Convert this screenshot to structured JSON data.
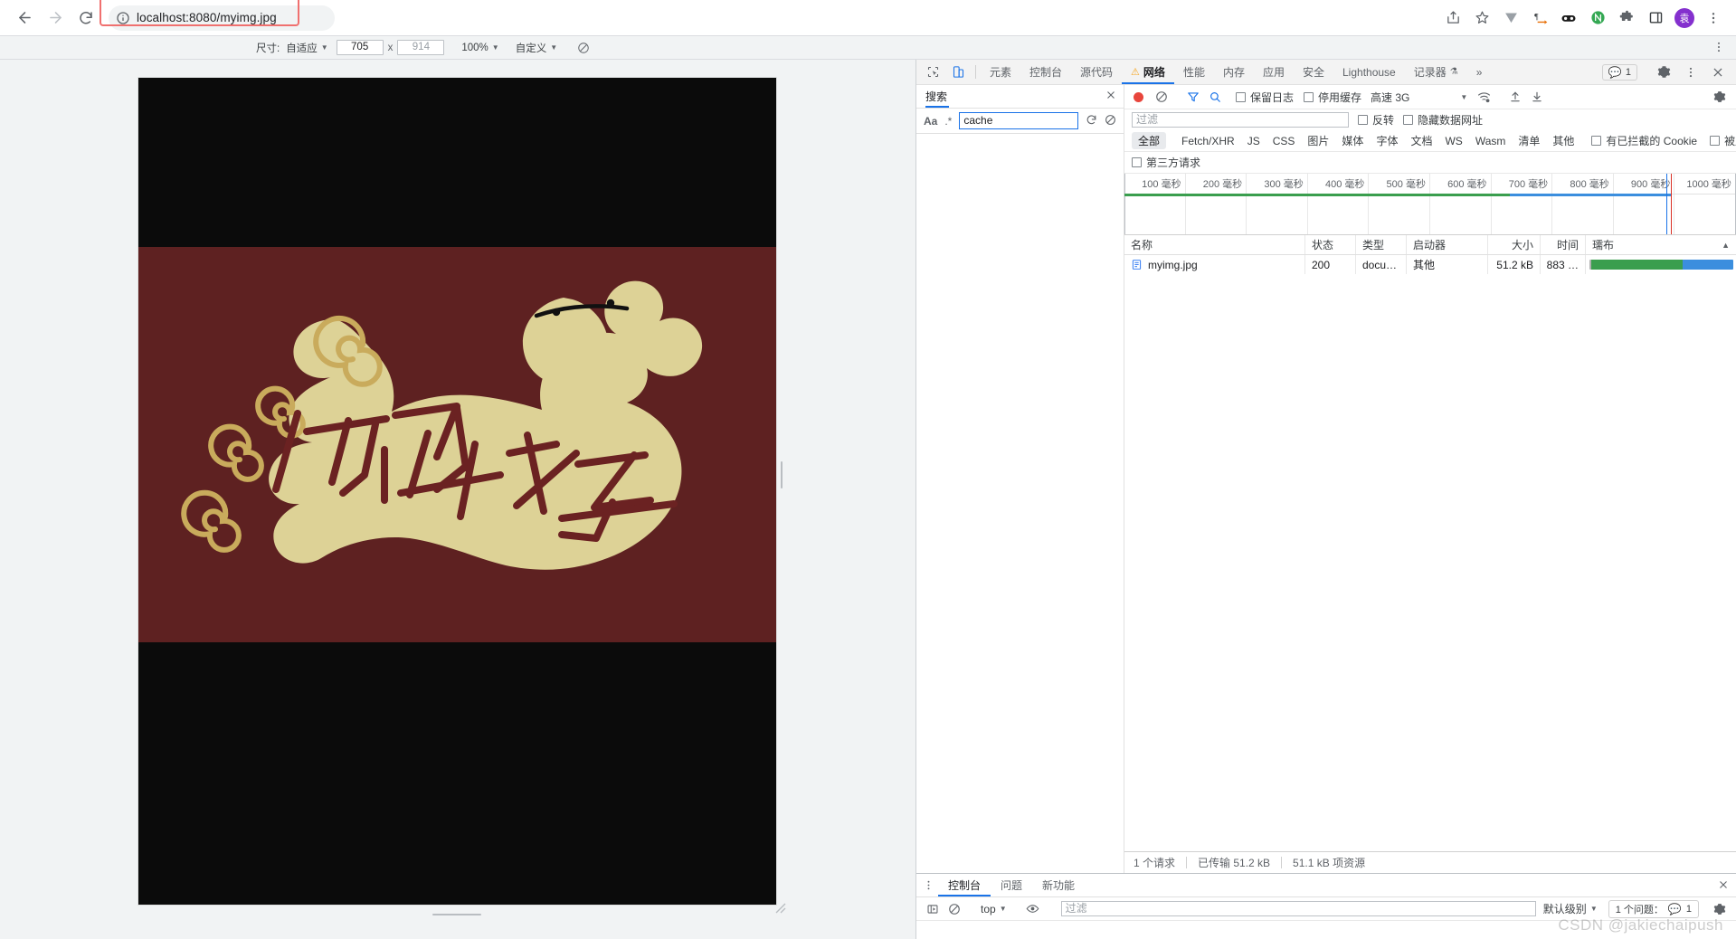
{
  "browser": {
    "back_icon": "arrow-left-icon",
    "forward_icon": "arrow-right-icon",
    "reload_icon": "reload-icon",
    "site_info_icon": "info-circle-icon",
    "url": "localhost:8080/myimg.jpg",
    "toolbar_icons": [
      "share-icon",
      "bookmark-star-icon",
      "vimium-icon",
      "paragraph-icon",
      "glasses-icon",
      "notion-icon",
      "extensions-puzzle-icon",
      "side-panel-icon",
      "profile-avatar",
      "chrome-menu-kebab-icon"
    ],
    "avatar_glyph": "袁"
  },
  "device_toolbar": {
    "size_label": "尺寸:",
    "size_value": "自适应",
    "width": "705",
    "x_separator": "x",
    "height": "914",
    "zoom": "100%",
    "throttle_preset": "自定义",
    "rotate_icon": "rotate-device-icon",
    "kebab_icon": "more-options-kebab-icon"
  },
  "page_image": {
    "colors": {
      "band": "#0b0b0b",
      "background": "#5e2121",
      "creature": "#ddd296",
      "spiral": "#c9ab5c",
      "stroke": "#6b2222",
      "face": "#111111"
    },
    "caption_text": "你好"
  },
  "devtools": {
    "left_icons": [
      "inspect-element-icon",
      "toggle-device-toolbar-icon"
    ],
    "tabs": [
      {
        "label": "元素",
        "selected": false,
        "warning": false
      },
      {
        "label": "控制台",
        "selected": false,
        "warning": false
      },
      {
        "label": "源代码",
        "selected": false,
        "warning": false
      },
      {
        "label": "网络",
        "selected": true,
        "warning": true
      },
      {
        "label": "性能",
        "selected": false,
        "warning": false
      },
      {
        "label": "内存",
        "selected": false,
        "warning": false
      },
      {
        "label": "应用",
        "selected": false,
        "warning": false
      },
      {
        "label": "安全",
        "selected": false,
        "warning": false
      },
      {
        "label": "Lighthouse",
        "selected": false,
        "warning": false
      },
      {
        "label": "记录器",
        "selected": false,
        "warning": false
      }
    ],
    "overflow_label": "»",
    "issue_count": "1",
    "settings_icon": "gear-icon",
    "main_kebab_icon": "more-options-kebab-icon",
    "close_icon": "close-icon"
  },
  "search_panel": {
    "title": "搜索",
    "close_icon": "close-icon",
    "match_case_label": "Aa",
    "regex_label": ".*",
    "query": "cache",
    "refresh_icon": "refresh-icon",
    "clear_icon": "clear-icon"
  },
  "network": {
    "record_icon": "record-dot-icon",
    "clear_icon": "clear-icon",
    "filter_icon": "funnel-filter-icon",
    "search_icon": "search-icon",
    "preserve_log_label": "保留日志",
    "preserve_log_checked": false,
    "disable_cache_label": "停用缓存",
    "disable_cache_checked": false,
    "throttle_value": "高速 3G",
    "wifi_icon": "network-conditions-icon",
    "import_icon": "import-har-icon",
    "export_icon": "export-har-icon",
    "settings_icon": "gear-icon",
    "filter_placeholder": "过滤",
    "invert_label": "反转",
    "invert_checked": false,
    "hide_data_urls_label": "隐藏数据网址",
    "hide_data_urls_checked": false,
    "type_chips": [
      "全部",
      "Fetch/XHR",
      "JS",
      "CSS",
      "图片",
      "媒体",
      "字体",
      "文档",
      "WS",
      "Wasm",
      "清单",
      "其他"
    ],
    "active_chip": "全部",
    "blocked_cookies_label": "有已拦截的 Cookie",
    "blocked_cookies_checked": false,
    "blocked_requests_label": "被屏蔽的请求",
    "blocked_requests_checked": false,
    "third_party_label": "第三方请求",
    "third_party_checked": false,
    "timeline_ticks": [
      "100 毫秒",
      "200 毫秒",
      "300 毫秒",
      "400 毫秒",
      "500 毫秒",
      "600 毫秒",
      "700 毫秒",
      "800 毫秒",
      "900 毫秒",
      "1000 毫秒"
    ],
    "columns": [
      "名称",
      "状态",
      "类型",
      "启动器",
      "大小",
      "时间",
      "瓀布"
    ],
    "sort_arrow": "▲",
    "rows": [
      {
        "icon": "document-file-icon",
        "name": "myimg.jpg",
        "status": "200",
        "type": "docu…",
        "initiator": "其他",
        "size": "51.2 kB",
        "time": "883 …"
      }
    ],
    "status_bar": {
      "requests": "1 个请求",
      "transferred": "已传输 51.2 kB",
      "resources": "51.1 kB 项资源"
    }
  },
  "drawer": {
    "kebab_icon": "more-options-kebab-icon",
    "tabs": [
      {
        "label": "控制台",
        "selected": true
      },
      {
        "label": "问题",
        "selected": false
      },
      {
        "label": "新功能",
        "selected": false
      }
    ],
    "close_icon": "close-icon",
    "sidebar_icon": "console-sidebar-icon",
    "clear_icon": "clear-console-icon",
    "context": "top",
    "eye_icon": "live-expression-eye-icon",
    "filter_placeholder": "过滤",
    "level": "默认级别",
    "issues_label": "1 个问题：",
    "issues_count": "1",
    "settings_icon": "gear-icon"
  },
  "watermark": "CSDN @jakiechaipush"
}
